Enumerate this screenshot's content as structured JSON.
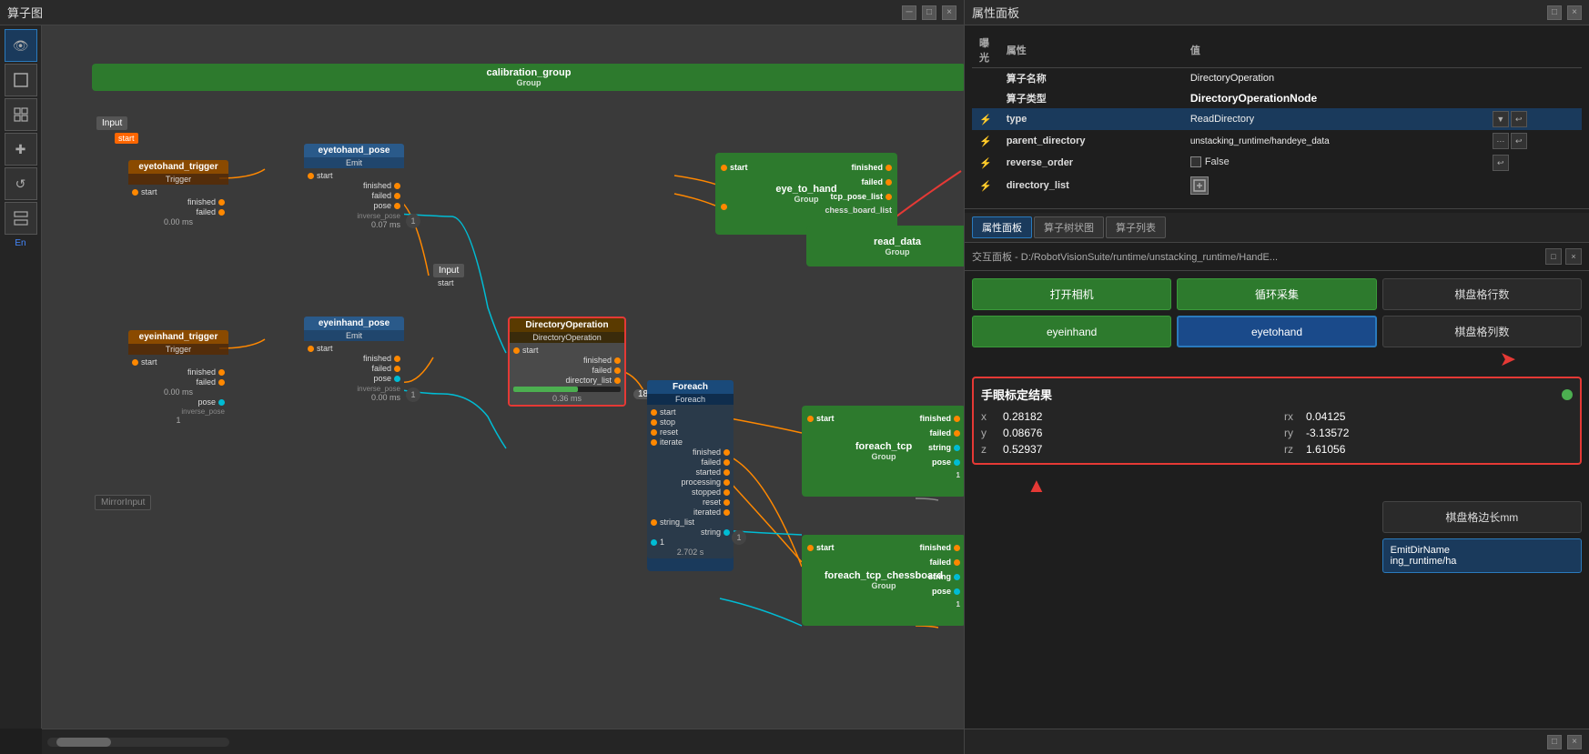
{
  "leftPanel": {
    "title": "算子图",
    "controls": [
      "□",
      "×"
    ]
  },
  "rightPanel": {
    "title": "属性面板",
    "controls": [
      "□",
      "×"
    ]
  },
  "sidebarIcons": [
    {
      "name": "eye-icon",
      "symbol": "👁",
      "active": true
    },
    {
      "name": "box-icon",
      "symbol": "⊡",
      "active": false
    },
    {
      "name": "connect-icon",
      "symbol": "⊞",
      "active": false
    },
    {
      "name": "cursor-icon",
      "symbol": "✚",
      "active": false
    },
    {
      "name": "refresh-icon",
      "symbol": "↺",
      "active": false
    },
    {
      "name": "layers-icon",
      "symbol": "⊟",
      "active": false
    }
  ],
  "properties": {
    "headers": [
      "曝光",
      "属性",
      "值"
    ],
    "rows": [
      {
        "icon": "",
        "name": "算子名称",
        "value": "DirectoryOperation",
        "highlight": false
      },
      {
        "icon": "",
        "name": "算子类型",
        "value": "DirectoryOperationNode",
        "highlight": true
      },
      {
        "icon": "⚡",
        "name": "type",
        "value": "ReadDirectory",
        "highlight": false,
        "hasBtn": true,
        "selected": true
      },
      {
        "icon": "⚡",
        "name": "parent_directory",
        "value": "unstacking_runtime/handeye_data",
        "highlight": false,
        "hasBtn": true
      },
      {
        "icon": "⚡",
        "name": "reverse_order",
        "value": "False",
        "highlight": false,
        "isCheckbox": true
      },
      {
        "icon": "⚡",
        "name": "directory_list",
        "value": "",
        "highlight": false,
        "hasSpecial": true
      }
    ]
  },
  "tabs": [
    {
      "label": "属性面板",
      "active": true
    },
    {
      "label": "算子树状图",
      "active": false
    },
    {
      "label": "算子列表",
      "active": false
    }
  ],
  "exchangePanel": {
    "label": "交互面板 - D:/RobotVisionSuite/runtime/unstacking_runtime/HandE..."
  },
  "buttons": {
    "openCamera": "打开相机",
    "loopCapture": "循环采集",
    "chessboardRows": "棋盘格行数",
    "eyeinhand": "eyeinhand",
    "eyetohand": "eyetohand",
    "chessboardCols": "棋盘格列数",
    "handeyeResult": "手眼标定结果",
    "chessboardSide": "棋盘格边长mm",
    "emitDirName": "EmitDirName",
    "emitDirPath": "ing_runtime/ha"
  },
  "handeyeValues": {
    "x": "0.28182",
    "rx": "0.04125",
    "y": "0.08676",
    "ry": "-3.13572",
    "z": "0.52937",
    "rz": "1.61056"
  },
  "nodes": {
    "calibrationGroup": {
      "label": "calibration_group",
      "sub": "Group"
    },
    "eyetohandPose": {
      "label": "eyetohand_pose",
      "sub": "Emit"
    },
    "eyetohandTrigger": {
      "label": "eyetohand_trigger",
      "sub": "Trigger",
      "time": "0.00 ms"
    },
    "eyeinhandPose": {
      "label": "eyeinhand_pose",
      "sub": "Emit"
    },
    "eyeinhandTrigger": {
      "label": "eyeinhand_trigger",
      "sub": "Trigger",
      "time": "0.00 ms"
    },
    "eyeToHand": {
      "label": "eye_to_hand",
      "sub": "Group"
    },
    "readData": {
      "label": "read_data",
      "sub": "Group"
    },
    "directoryOp": {
      "label": "DirectoryOperation",
      "sub": "DirectoryOperation",
      "time": "0.36 ms"
    },
    "foreach": {
      "label": "Foreach",
      "sub": "Foreach"
    },
    "foreachTcp": {
      "label": "foreach_tcp",
      "sub": "Group"
    },
    "foreachTcpChessboard": {
      "label": "foreach_tcp_chessboard",
      "sub": "Group"
    }
  }
}
